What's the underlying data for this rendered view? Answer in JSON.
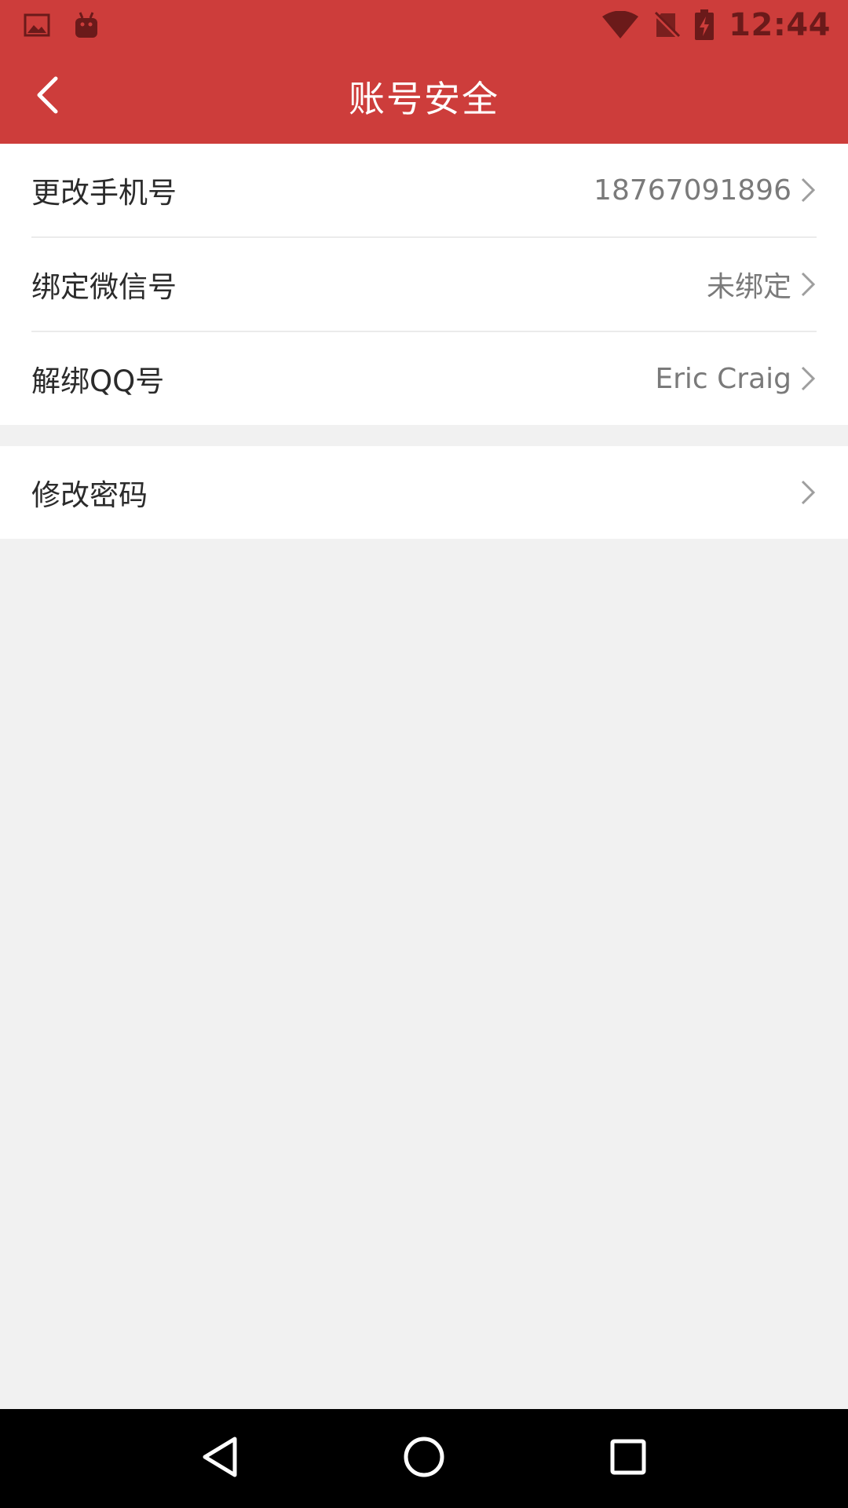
{
  "status_bar": {
    "time": "12:44",
    "icons": [
      "gallery-icon",
      "android-debug-icon",
      "wifi-icon",
      "no-sim-icon",
      "battery-charging-icon"
    ],
    "text_color": "#6b1a1a"
  },
  "app_bar": {
    "title": "账号安全",
    "back_icon": "chevron-left-icon",
    "background_color": "#cd3d3b"
  },
  "groups": [
    {
      "items": [
        {
          "label": "更改手机号",
          "value": "18767091896"
        },
        {
          "label": "绑定微信号",
          "value": "未绑定"
        },
        {
          "label": "解绑QQ号",
          "value": "Eric Craig"
        }
      ]
    },
    {
      "items": [
        {
          "label": "修改密码",
          "value": ""
        }
      ]
    }
  ],
  "nav_bar": {
    "buttons": [
      "back-triangle-icon",
      "home-circle-icon",
      "recents-square-icon"
    ]
  }
}
